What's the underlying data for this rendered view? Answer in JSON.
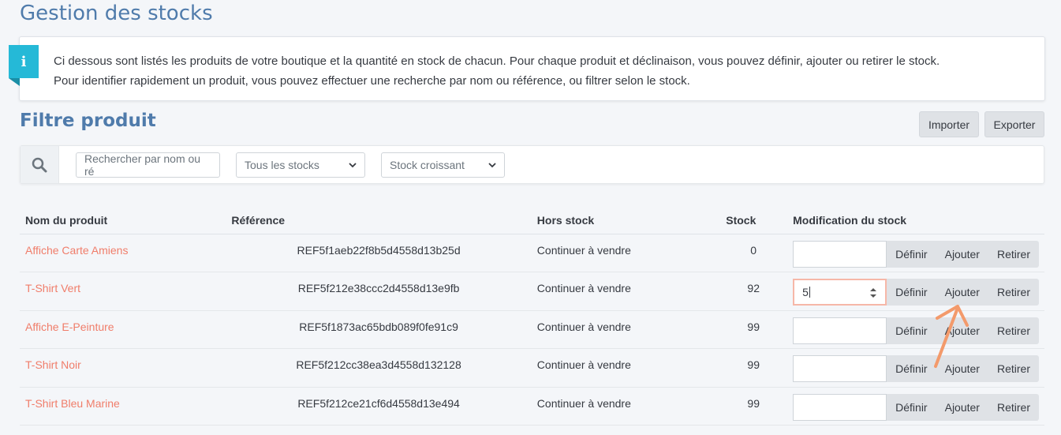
{
  "page": {
    "title": "Gestion des stocks",
    "info_lines": [
      "Ci dessous sont listés les produits de votre boutique et la quantité en stock de chacun. Pour chaque produit et déclinaison, vous pouvez définir, ajouter ou retirer le stock.",
      "Pour identifier rapidement un produit, vous pouvez effectuer une recherche par nom ou référence, ou filtrer selon le stock."
    ],
    "info_icon": "info-icon",
    "filter_title": "Filtre produit",
    "import_label": "Importer",
    "export_label": "Exporter"
  },
  "filters": {
    "search_placeholder": "Rechercher par nom ou ré",
    "stock_filter": "Tous les stocks",
    "sort": "Stock croissant"
  },
  "table": {
    "headers": {
      "name": "Nom du produit",
      "reference": "Référence",
      "out_of_stock": "Hors stock",
      "stock": "Stock",
      "modification": "Modification du stock"
    },
    "rows": [
      {
        "name": "Affiche Carte Amiens",
        "reference": "REF5f1aeb22f8b5d4558d13b25d",
        "out_of_stock": "Continuer à vendre",
        "stock": "0",
        "qty": ""
      },
      {
        "name": "T-Shirt Vert",
        "reference": "REF5f212e38ccc2d4558d13e9fb",
        "out_of_stock": "Continuer à vendre",
        "stock": "92",
        "qty": "5"
      },
      {
        "name": "Affiche E-Peinture",
        "reference": "REF5f1873ac65bdb089f0fe91c9",
        "out_of_stock": "Continuer à vendre",
        "stock": "99",
        "qty": ""
      },
      {
        "name": "T-Shirt Noir",
        "reference": "REF5f212cc38ea3d4558d132128",
        "out_of_stock": "Continuer à vendre",
        "stock": "99",
        "qty": ""
      },
      {
        "name": "T-Shirt Bleu Marine",
        "reference": "REF5f212ce21cf6d4558d13e494",
        "out_of_stock": "Continuer à vendre",
        "stock": "99",
        "qty": ""
      }
    ],
    "actions": {
      "set": "Définir",
      "add": "Ajouter",
      "remove": "Retirer"
    }
  },
  "colors": {
    "title": "#4f7bab",
    "link": "#f07d6a",
    "info": "#25b9d7",
    "arrow": "#f39a6b"
  }
}
